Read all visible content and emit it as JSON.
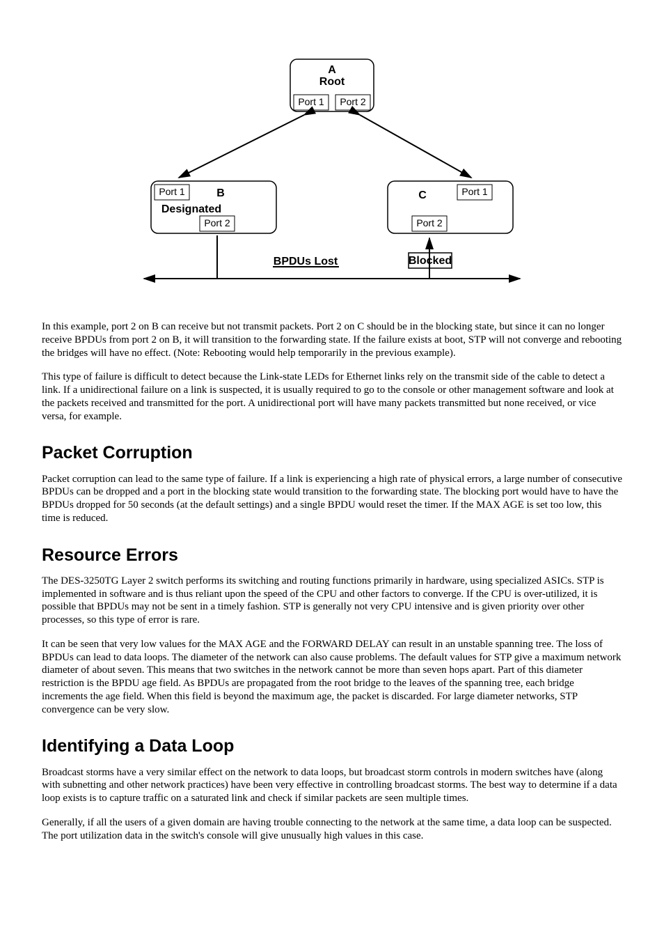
{
  "diagram": {
    "node_a_label": "A",
    "node_a_sub": "Root",
    "node_a_port1": "Port 1",
    "node_a_port2": "Port 2",
    "node_b_label": "B",
    "node_b_sub": "Designated",
    "node_b_port1": "Port 1",
    "node_b_port2": "Port 2",
    "node_c_label": "C",
    "node_c_port1": "Port 1",
    "node_c_port2": "Port 2",
    "bpdus_lost": "BPDUs Lost",
    "blocked": "Blocked"
  },
  "paragraphs": {
    "p1": "In this example, port 2 on B can receive but not transmit packets. Port 2 on C should be in the blocking state, but since it can no longer receive BPDUs from port 2 on B, it will transition to the forwarding state. If the failure exists at boot, STP will not converge and rebooting the bridges will have no effect.  (Note: Rebooting would help temporarily in the previous example).",
    "p2": "This type of failure is difficult to detect because the Link-state LEDs for Ethernet links rely on the transmit side of the cable to detect a link. If a unidirectional failure on a link is suspected, it is usually required to go to the console or other management software and look at the packets received and transmitted for the port. A unidirectional port will have many packets transmitted but none received, or vice versa, for example.",
    "p3": "Packet corruption can lead to the same type of failure. If a link is experiencing a high rate of physical errors, a large number of consecutive BPDUs can be dropped and a port in the blocking state would transition to the forwarding state. The blocking port would have to have the BPDUs dropped for 50 seconds (at the default settings) and a single BPDU would reset the timer.  If the MAX AGE is set too low, this time is reduced.",
    "p4": "The DES-3250TG Layer 2 switch performs its switching and routing functions primarily in hardware, using specialized ASICs. STP is implemented in software and is thus reliant upon the speed of the CPU and other factors to converge. If the CPU is over-utilized, it is possible that BPDUs may not be sent in a timely fashion. STP is generally not very CPU intensive and is given priority over other processes, so this type of error is rare.",
    "p5": "It can be seen that very low values for the MAX AGE and the FORWARD DELAY can result in an unstable spanning tree. The loss of BPDUs can lead to data loops. The diameter of the network can also cause problems. The default values for STP give a maximum network diameter of about seven. This means that two switches in the network cannot be more than seven hops apart. Part of this diameter restriction is the BPDU age field. As BPDUs are propagated from the root bridge to the leaves of the spanning tree, each bridge increments the age field. When this field is beyond the maximum age, the packet is discarded. For large diameter networks, STP convergence can be very slow.",
    "p6": "Broadcast storms have a very similar effect on the network to data loops, but broadcast storm controls in modern switches have (along with subnetting and other network practices) have been very effective in controlling broadcast storms. The best way to determine if a data loop exists is to capture traffic on a saturated link and check if similar packets are seen multiple times.",
    "p7": "Generally, if all the users of a given domain are having trouble connecting to the network at the same time, a data loop can be suspected. The port utilization data in the switch's console will give unusually high values in this case."
  },
  "headings": {
    "h1": "Packet Corruption",
    "h2": "Resource Errors",
    "h3": "Identifying a Data Loop"
  }
}
